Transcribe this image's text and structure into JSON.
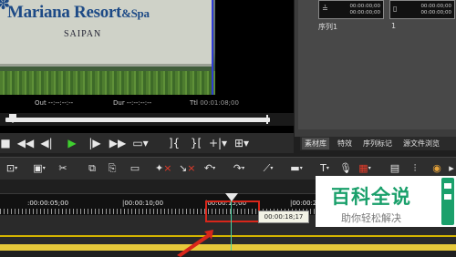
{
  "preview": {
    "sign_title": "Mariana Resort",
    "sign_title_suffix": "&Spa",
    "sign_subtitle": "SAIPAN",
    "in_label": "Out --:--:--:--",
    "dur_label": "Dur --:--:--:--",
    "ttl_label": "Ttl",
    "ttl_value": "00:01:08;00"
  },
  "bin": {
    "thumb1_tc1": "00:00:00;00",
    "thumb1_tc2": "00:00:00;00",
    "thumb2_tc1": "00:00:00;00",
    "thumb2_tc2": "00:00:00;00",
    "sequence1": "序列1",
    "sequence2": "1",
    "tabs": [
      "素材库",
      "特效",
      "序列标记",
      "源文件浏览"
    ]
  },
  "transport": {
    "play_icon": "play-icon"
  },
  "timeline": {
    "ruler_labels": [
      ":00:00:05;00",
      "|00:00:10;00",
      "|00:00:15;00",
      "|00:00:20;00"
    ],
    "tooltip": "00:00:18;17",
    "accent": "#d8261a",
    "playhead_color": "#4bd1a0"
  },
  "watermark": {
    "title": "百科全说",
    "subtitle": "助你轻松解决"
  },
  "colors": {
    "track_yellow": "#e7c93a",
    "brand_green": "#1aa06b"
  }
}
